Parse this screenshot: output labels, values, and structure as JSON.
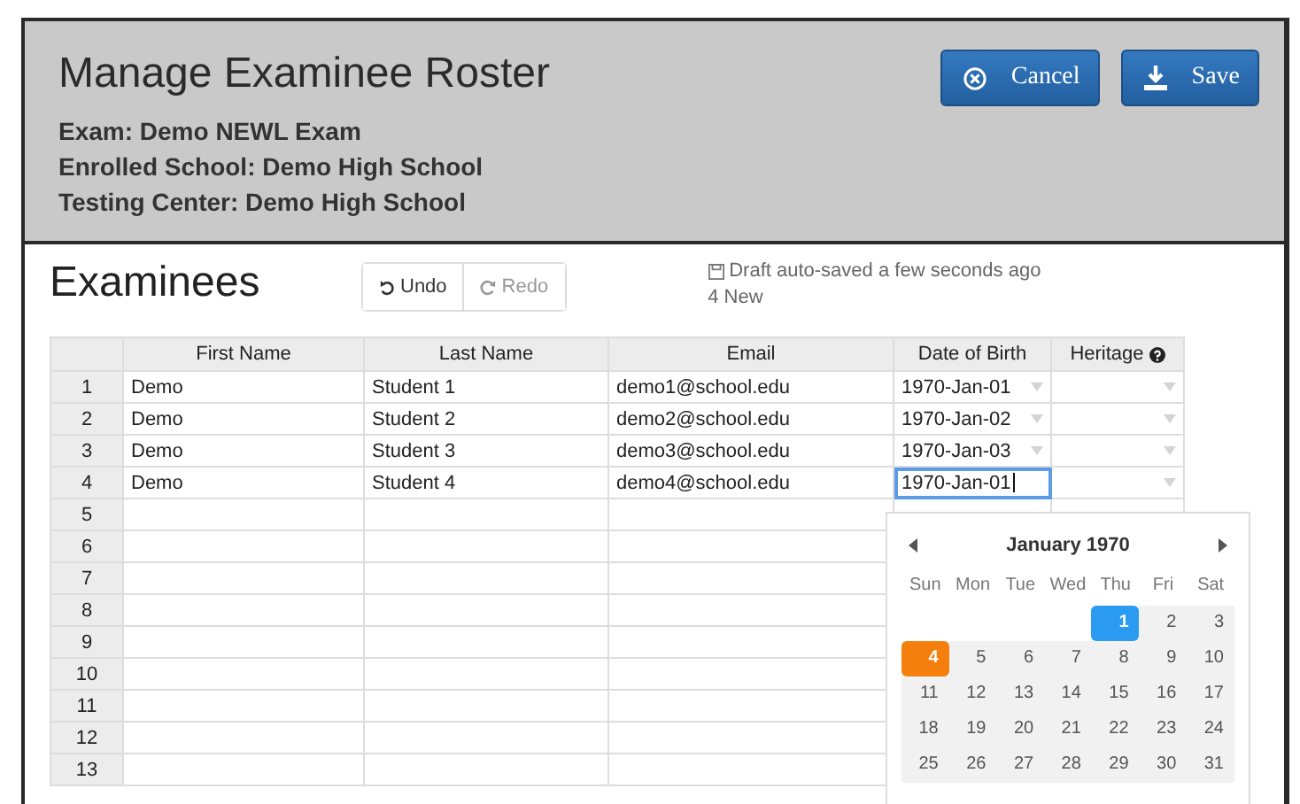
{
  "header": {
    "title": "Manage Examinee Roster",
    "details": [
      "Exam: Demo NEWL Exam",
      "Enrolled School: Demo High School",
      "Testing Center: Demo High School"
    ],
    "buttons": [
      {
        "kind": "cancel",
        "label": "Cancel"
      },
      {
        "kind": "save",
        "label": "Save"
      }
    ]
  },
  "section": {
    "title": "Examinees",
    "history": [
      {
        "kind": "undo",
        "label": "Undo",
        "disabled": false
      },
      {
        "kind": "redo",
        "label": "Redo",
        "disabled": true
      }
    ],
    "status": "Draft auto-saved a few seconds ago",
    "count": "4 New"
  },
  "table": {
    "columns": [
      "First Name",
      "Last Name",
      "Email",
      "Date of Birth",
      "Heritage"
    ],
    "rows": [
      {
        "number": "1",
        "first_name": "Demo",
        "last_name": "Student 1",
        "email": "demo1@school.edu",
        "date_of_birth": "1970-Jan-01",
        "editing": false
      },
      {
        "number": "2",
        "first_name": "Demo",
        "last_name": "Student 2",
        "email": "demo2@school.edu",
        "date_of_birth": "1970-Jan-02",
        "editing": false
      },
      {
        "number": "3",
        "first_name": "Demo",
        "last_name": "Student 3",
        "email": "demo3@school.edu",
        "date_of_birth": "1970-Jan-03",
        "editing": false
      },
      {
        "number": "4",
        "first_name": "Demo",
        "last_name": "Student 4",
        "email": "demo4@school.edu",
        "date_of_birth": "1970-Jan-01",
        "editing": true
      },
      {
        "number": "5"
      },
      {
        "number": "6"
      },
      {
        "number": "7"
      },
      {
        "number": "8"
      },
      {
        "number": "9"
      },
      {
        "number": "10"
      },
      {
        "number": "11"
      },
      {
        "number": "12"
      },
      {
        "number": "13"
      }
    ]
  },
  "calendar": {
    "month": "January 1970",
    "weekdays": [
      "Sun",
      "Mon",
      "Tue",
      "Wed",
      "Thu",
      "Fri",
      "Sat"
    ],
    "weeks": [
      [
        {
          "day": "1",
          "selected": true,
          "today": false
        },
        {
          "day": "2",
          "selected": false,
          "today": false
        },
        {
          "day": "3",
          "selected": false,
          "today": false
        }
      ],
      [
        {
          "day": "4",
          "selected": false,
          "today": true
        },
        {
          "day": "5",
          "selected": false,
          "today": false
        },
        {
          "day": "6",
          "selected": false,
          "today": false
        },
        {
          "day": "7",
          "selected": false,
          "today": false
        },
        {
          "day": "8",
          "selected": false,
          "today": false
        },
        {
          "day": "9",
          "selected": false,
          "today": false
        },
        {
          "day": "10",
          "selected": false,
          "today": false
        }
      ],
      [
        {
          "day": "11",
          "selected": false,
          "today": false
        },
        {
          "day": "12",
          "selected": false,
          "today": false
        },
        {
          "day": "13",
          "selected": false,
          "today": false
        },
        {
          "day": "14",
          "selected": false,
          "today": false
        },
        {
          "day": "15",
          "selected": false,
          "today": false
        },
        {
          "day": "16",
          "selected": false,
          "today": false
        },
        {
          "day": "17",
          "selected": false,
          "today": false
        }
      ],
      [
        {
          "day": "18",
          "selected": false,
          "today": false
        },
        {
          "day": "19",
          "selected": false,
          "today": false
        },
        {
          "day": "20",
          "selected": false,
          "today": false
        },
        {
          "day": "21",
          "selected": false,
          "today": false
        },
        {
          "day": "22",
          "selected": false,
          "today": false
        },
        {
          "day": "23",
          "selected": false,
          "today": false
        },
        {
          "day": "24",
          "selected": false,
          "today": false
        }
      ],
      [
        {
          "day": "25",
          "selected": false,
          "today": false
        },
        {
          "day": "26",
          "selected": false,
          "today": false
        },
        {
          "day": "27",
          "selected": false,
          "today": false
        },
        {
          "day": "28",
          "selected": false,
          "today": false
        },
        {
          "day": "29",
          "selected": false,
          "today": false
        },
        {
          "day": "30",
          "selected": false,
          "today": false
        },
        {
          "day": "31",
          "selected": false,
          "today": false
        }
      ]
    ]
  }
}
